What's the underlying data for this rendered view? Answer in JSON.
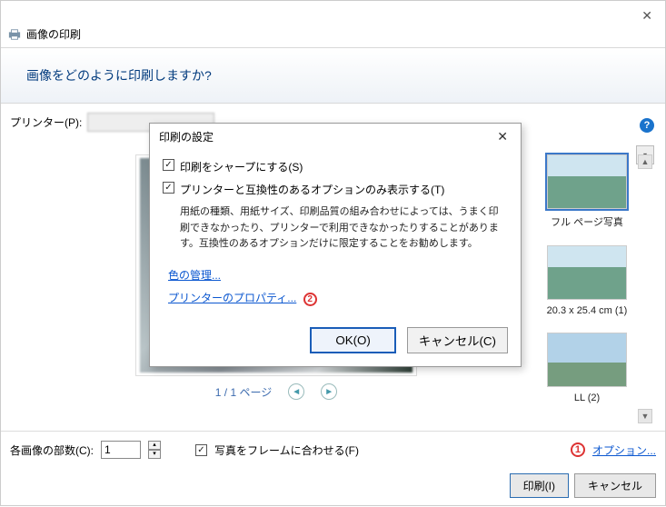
{
  "main": {
    "title": "画像の印刷",
    "question": "画像をどのように印刷しますか?",
    "printer_label": "プリンター(P):",
    "pager_text": "1 / 1 ページ"
  },
  "layouts": [
    {
      "label": "フル ページ写真",
      "selected": true
    },
    {
      "label": "20.3 x 25.4 cm (1)",
      "selected": false
    },
    {
      "label": "LL (2)",
      "selected": false
    }
  ],
  "footer": {
    "copies_label": "各画像の部数(C):",
    "copies_value": "1",
    "fit_frame_label": "写真をフレームに合わせる(F)",
    "options_link": "オプション...",
    "options_badge": "①",
    "print_btn": "印刷(I)",
    "cancel_btn": "キャンセル"
  },
  "dialog": {
    "title": "印刷の設定",
    "chk_sharpen": "印刷をシャープにする(S)",
    "chk_compat": "プリンターと互換性のあるオプションのみ表示する(T)",
    "compat_desc": "用紙の種類、用紙サイズ、印刷品質の組み合わせによっては、うまく印刷できなかったり、プリンターで利用できなかったりすることがあります。互換性のあるオプションだけに限定することをお勧めします。",
    "color_mgmt": "色の管理...",
    "printer_props": "プリンターのプロパティ...",
    "printer_props_badge": "②",
    "ok": "OK(O)",
    "cancel": "キャンセル(C)"
  }
}
